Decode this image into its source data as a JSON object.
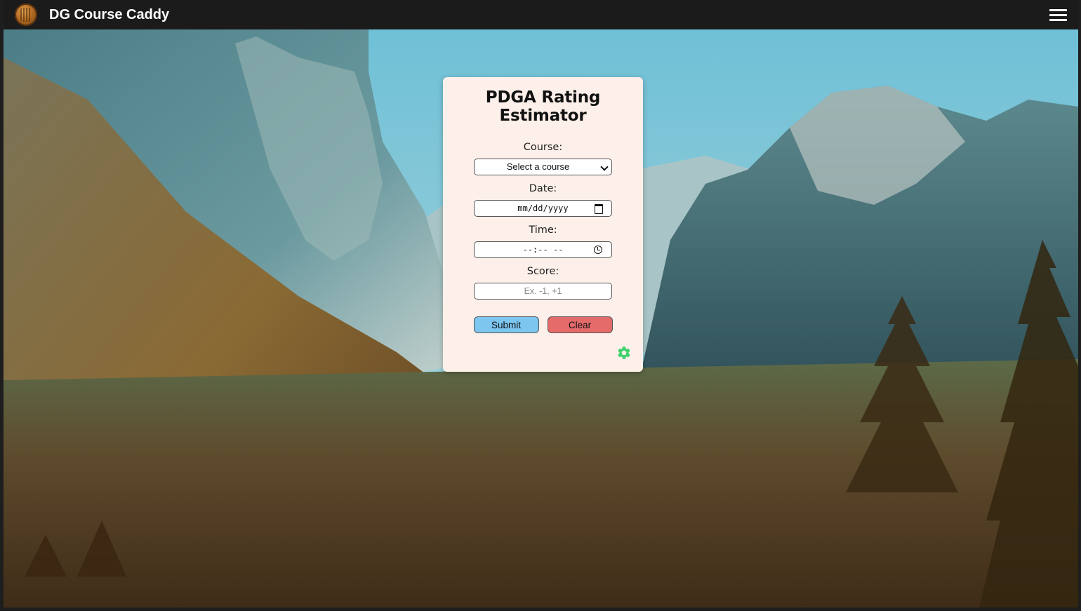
{
  "navbar": {
    "brand": "DG Course Caddy",
    "logo_icon": "disc-golf-logo-icon",
    "menu_icon": "hamburger-menu-icon"
  },
  "form": {
    "title": "PDGA Rating Estimator",
    "course_label": "Course:",
    "course_selected": "Select a course",
    "date_label": "Date:",
    "date_value": "mm/dd/yyyy",
    "time_label": "Time:",
    "time_value": "--:-- --",
    "score_label": "Score:",
    "score_placeholder": "Ex. -1, +1",
    "submit_label": "Submit",
    "clear_label": "Clear",
    "settings_icon": "gear-icon"
  },
  "colors": {
    "navbar": "#1b1b1b",
    "card_bg": "#fdf0ea",
    "submit": "#7cc6ef",
    "clear": "#e56a6a",
    "gear": "#3dd16a"
  }
}
